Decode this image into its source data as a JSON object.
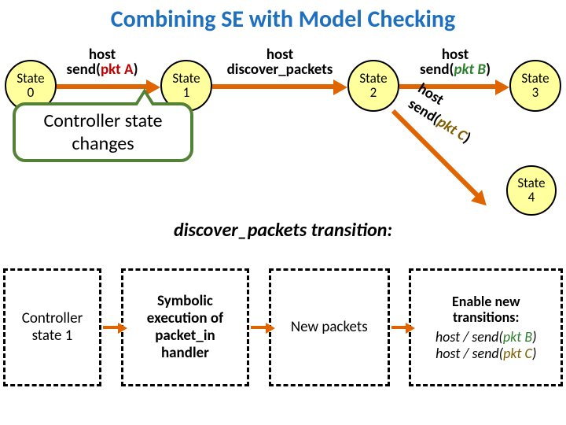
{
  "title": "Combining SE with Model Checking",
  "states": {
    "s0": "State\n0",
    "s1": "State\n1",
    "s2": "State\n2",
    "s3": "State\n3",
    "s4": "State\n4"
  },
  "transitions": {
    "t01_host": "host",
    "t01_label": "send(",
    "t01_pkt": "pkt A",
    "t01_close": ")",
    "t12_host": "host",
    "t12_label": "discover_packets",
    "t23_host": "host",
    "t23_label": "send(",
    "t23_pkt": "pkt B",
    "t23_close": ")",
    "t24_host": "host",
    "t24_label": "send(",
    "t24_pkt": "pkt C",
    "t24_close": ")"
  },
  "callout": "Controller state changes",
  "subtitle": "discover_packets transition:",
  "flow": {
    "b1": "Controller state 1",
    "b2": "Symbolic execution of packet_in handler",
    "b3": "New packets",
    "b4_title": "Enable new transitions:",
    "b4_l1_pre": "host / send(",
    "b4_l1_pkt": "pkt B",
    "b4_l1_post": ")",
    "b4_l2_pre": "host / send(",
    "b4_l2_pkt": "pkt C",
    "b4_l2_post": ")"
  }
}
